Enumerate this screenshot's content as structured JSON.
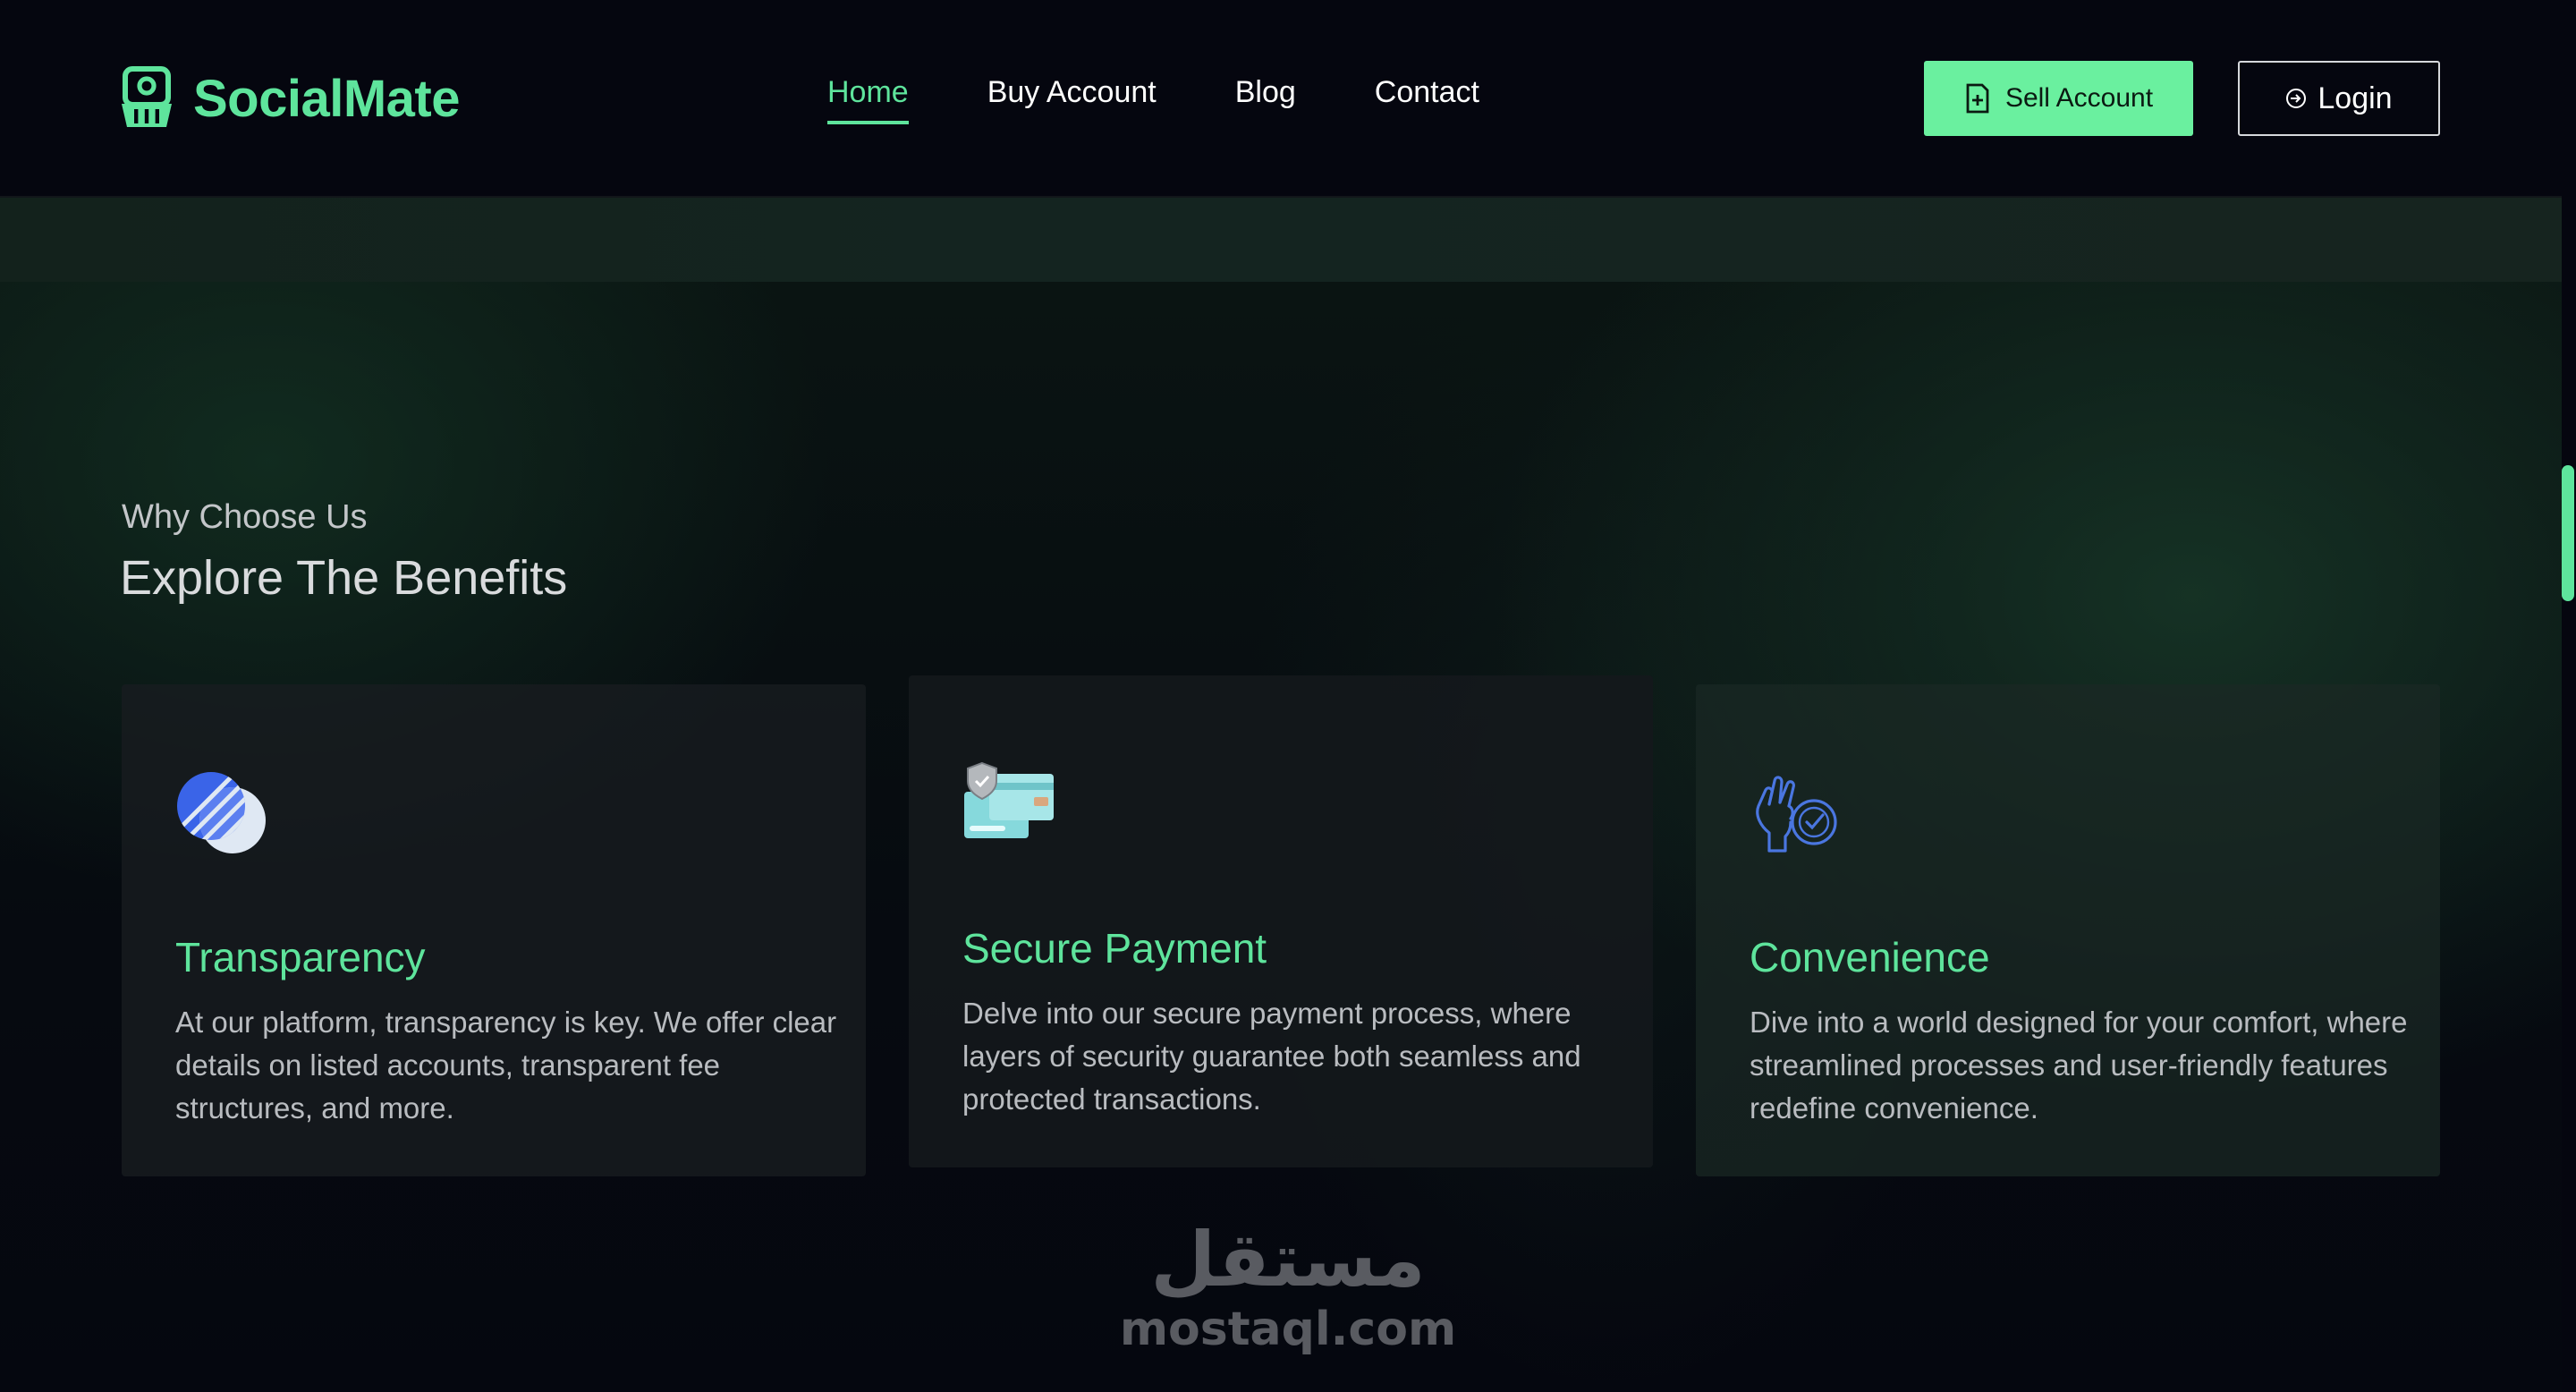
{
  "header": {
    "brand": "SocialMate",
    "nav": [
      {
        "label": "Home",
        "active": true
      },
      {
        "label": "Buy Account",
        "active": false
      },
      {
        "label": "Blog",
        "active": false
      },
      {
        "label": "Contact",
        "active": false
      }
    ],
    "sell_button": {
      "label": "Sell Account",
      "icon": "add-document-icon"
    },
    "login_button": {
      "label": "Login",
      "icon": "login-icon"
    }
  },
  "section": {
    "eyebrow": "Why Choose Us",
    "heading": "Explore The Benefits"
  },
  "cards": [
    {
      "title": "Transparency",
      "description": "At our platform, transparency is key. We offer clear details on listed accounts, transparent fee structures, and more.",
      "icon": "transparency-icon"
    },
    {
      "title": "Secure Payment",
      "description": "Delve into our secure payment process, where layers of security guarantee both seamless and protected transactions.",
      "icon": "secure-payment-icon"
    },
    {
      "title": "Convenience",
      "description": "Dive into a world designed for your comfort, where streamlined processes and user-friendly features redefine convenience.",
      "icon": "convenience-icon"
    }
  ],
  "watermark": {
    "arabic": "مستقل",
    "latin": "mostaql.com"
  },
  "colors": {
    "accent": "#5ee49c",
    "button_bg": "#6af09f",
    "background": "#05060f",
    "card_text": "#b9bcc0"
  }
}
